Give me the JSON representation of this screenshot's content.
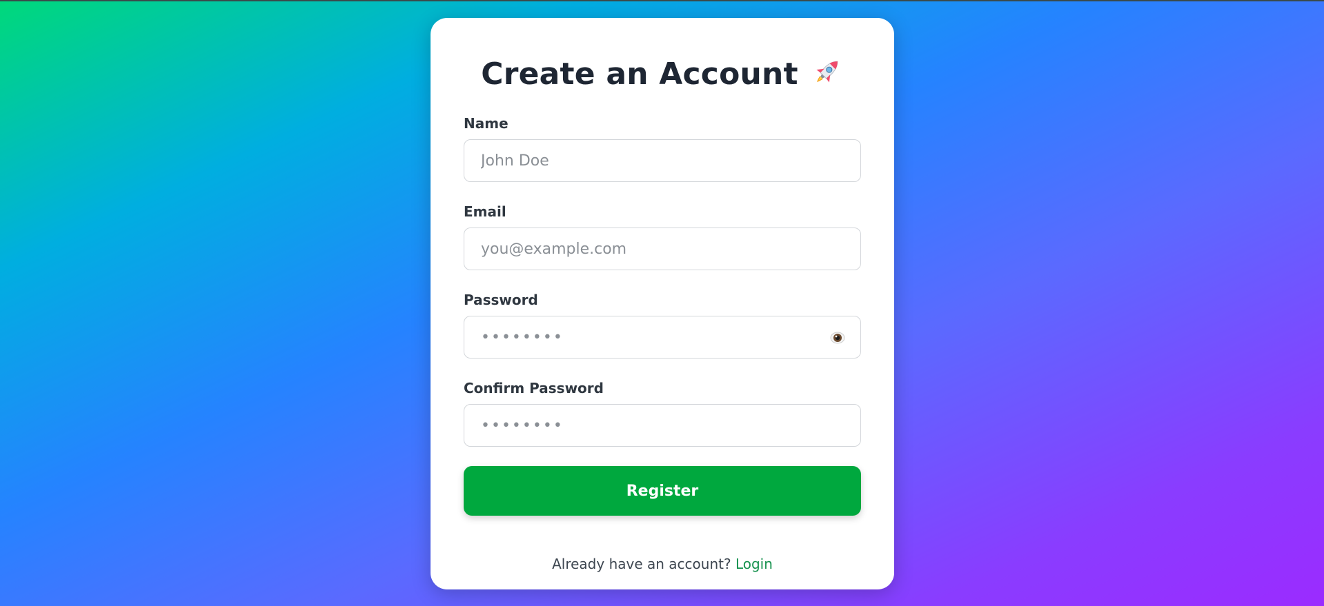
{
  "page": {
    "title": "Create an Account",
    "title_icon": "rocket-icon"
  },
  "form": {
    "name": {
      "label": "Name",
      "placeholder": "John Doe",
      "value": ""
    },
    "email": {
      "label": "Email",
      "placeholder": "you@example.com",
      "value": ""
    },
    "password": {
      "label": "Password",
      "placeholder": "••••••••",
      "value": "",
      "toggle_icon": "eye-icon"
    },
    "confirm_password": {
      "label": "Confirm Password",
      "placeholder": "••••••••",
      "value": ""
    },
    "submit_label": "Register"
  },
  "footer": {
    "prompt": "Already have an account?",
    "link_label": "Login"
  },
  "colors": {
    "accent": "#00a83e",
    "link": "#17924f",
    "title": "#1e2633",
    "background_start": "#00d97a",
    "background_end": "#9b2bff"
  }
}
